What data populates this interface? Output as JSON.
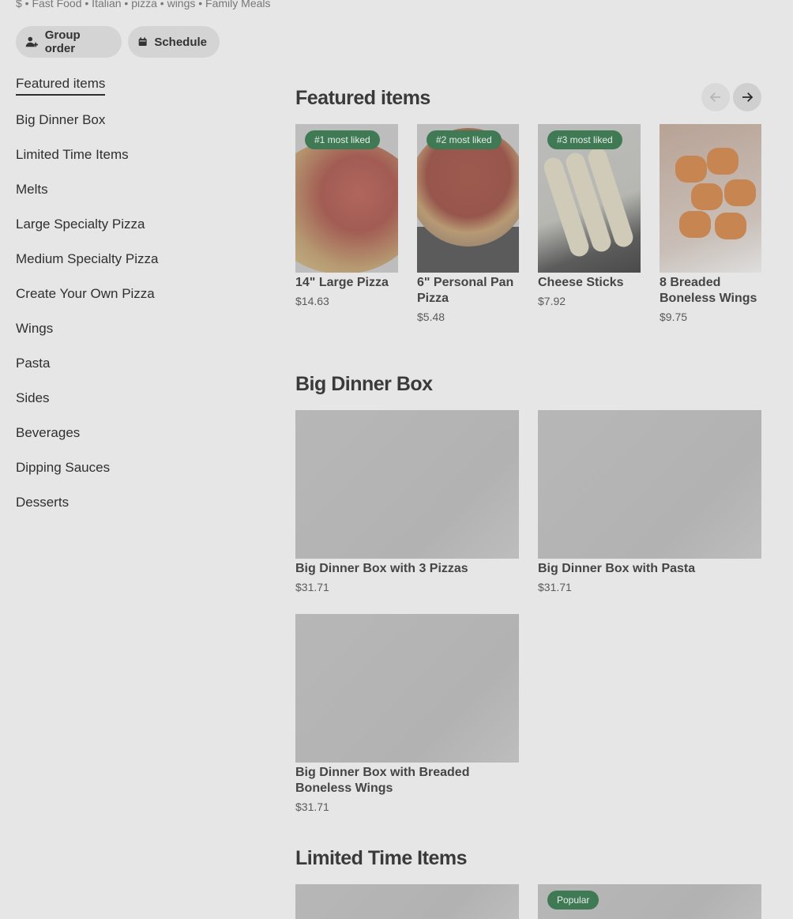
{
  "store": {
    "meta": "$ • Fast Food • Italian • pizza • wings • Family Meals"
  },
  "actions": {
    "group_order": "Group order",
    "schedule": "Schedule"
  },
  "nav": {
    "items": [
      {
        "label": "Featured items",
        "active": true
      },
      {
        "label": "Big Dinner Box"
      },
      {
        "label": "Limited Time Items"
      },
      {
        "label": "Melts"
      },
      {
        "label": "Large Specialty Pizza"
      },
      {
        "label": "Medium Specialty Pizza"
      },
      {
        "label": "Create Your Own Pizza"
      },
      {
        "label": "Wings"
      },
      {
        "label": "Pasta"
      },
      {
        "label": "Sides"
      },
      {
        "label": "Beverages"
      },
      {
        "label": "Dipping Sauces"
      },
      {
        "label": "Desserts"
      }
    ]
  },
  "featured": {
    "title": "Featured items",
    "items": [
      {
        "badge": "#1 most liked",
        "name": "14\" Large Pizza",
        "price": "$14.63"
      },
      {
        "badge": "#2 most liked",
        "name": "6\" Personal Pan Pizza",
        "price": "$5.48"
      },
      {
        "badge": "#3 most liked",
        "name": "Cheese Sticks",
        "price": "$7.92"
      },
      {
        "name": "8 Breaded Boneless Wings",
        "price": "$9.75"
      }
    ]
  },
  "big_dinner_box": {
    "title": "Big Dinner Box",
    "items": [
      {
        "name": "Big Dinner Box with 3 Pizzas",
        "price": "$31.71"
      },
      {
        "name": "Big Dinner Box with Pasta",
        "price": "$31.71"
      },
      {
        "name": "Big Dinner Box with Breaded Boneless Wings",
        "price": "$31.71"
      }
    ]
  },
  "limited_time": {
    "title": "Limited Time Items",
    "items": [
      {
        "badge": ""
      },
      {
        "badge": "Popular"
      }
    ]
  },
  "colors": {
    "badge_green": "#3f7a55",
    "overlay_gray": "#e6e6e6"
  }
}
